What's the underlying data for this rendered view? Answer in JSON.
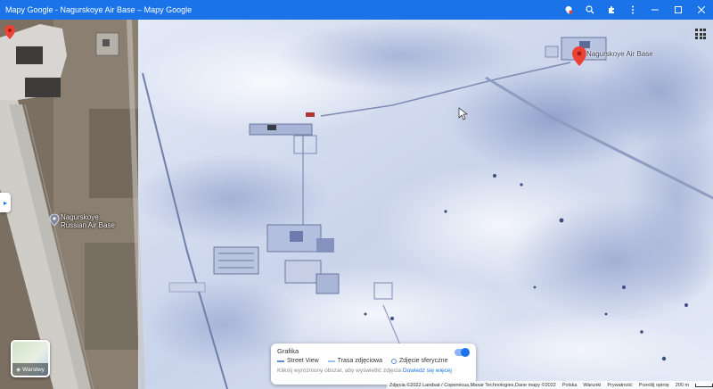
{
  "window": {
    "title": "Mapy Google - Nagurskoye Air Base – Mapy Google"
  },
  "toolbar": {
    "icons": [
      "share-icon",
      "zoom-icon",
      "extensions-icon",
      "menu-icon"
    ]
  },
  "map": {
    "labels": {
      "airbase_left_line1": "Nagurskoye",
      "airbase_left_line2": "Russian Air Base",
      "airbase_right": "Nagurskoye Air Base"
    },
    "layers_button_label": "Warstwy"
  },
  "street_view_panel": {
    "title": "Grafika",
    "legend": {
      "street_view": "Street View",
      "photo_route": "Trasa zdjęciowa",
      "spherical_photo": "Zdjęcie sferyczne"
    },
    "hint": "Kliknij wyróżniony obszar, aby wyświetlić zdjęcia",
    "link": "Dowiedz się więcej"
  },
  "footer": {
    "attribution": "Zdjęcia ©2022 Landsat / Copernicus,Maxar Technologies,Dane mapy ©2022",
    "country": "Polska",
    "terms": "Warunki",
    "privacy": "Prywatność",
    "feedback": "Prześlij opinię",
    "scale": "200 m"
  },
  "colors": {
    "titlebar": "#1a73e8",
    "snow": "#e9eef8",
    "shadow": "#7c8fc4",
    "pin": "#ea4335"
  }
}
